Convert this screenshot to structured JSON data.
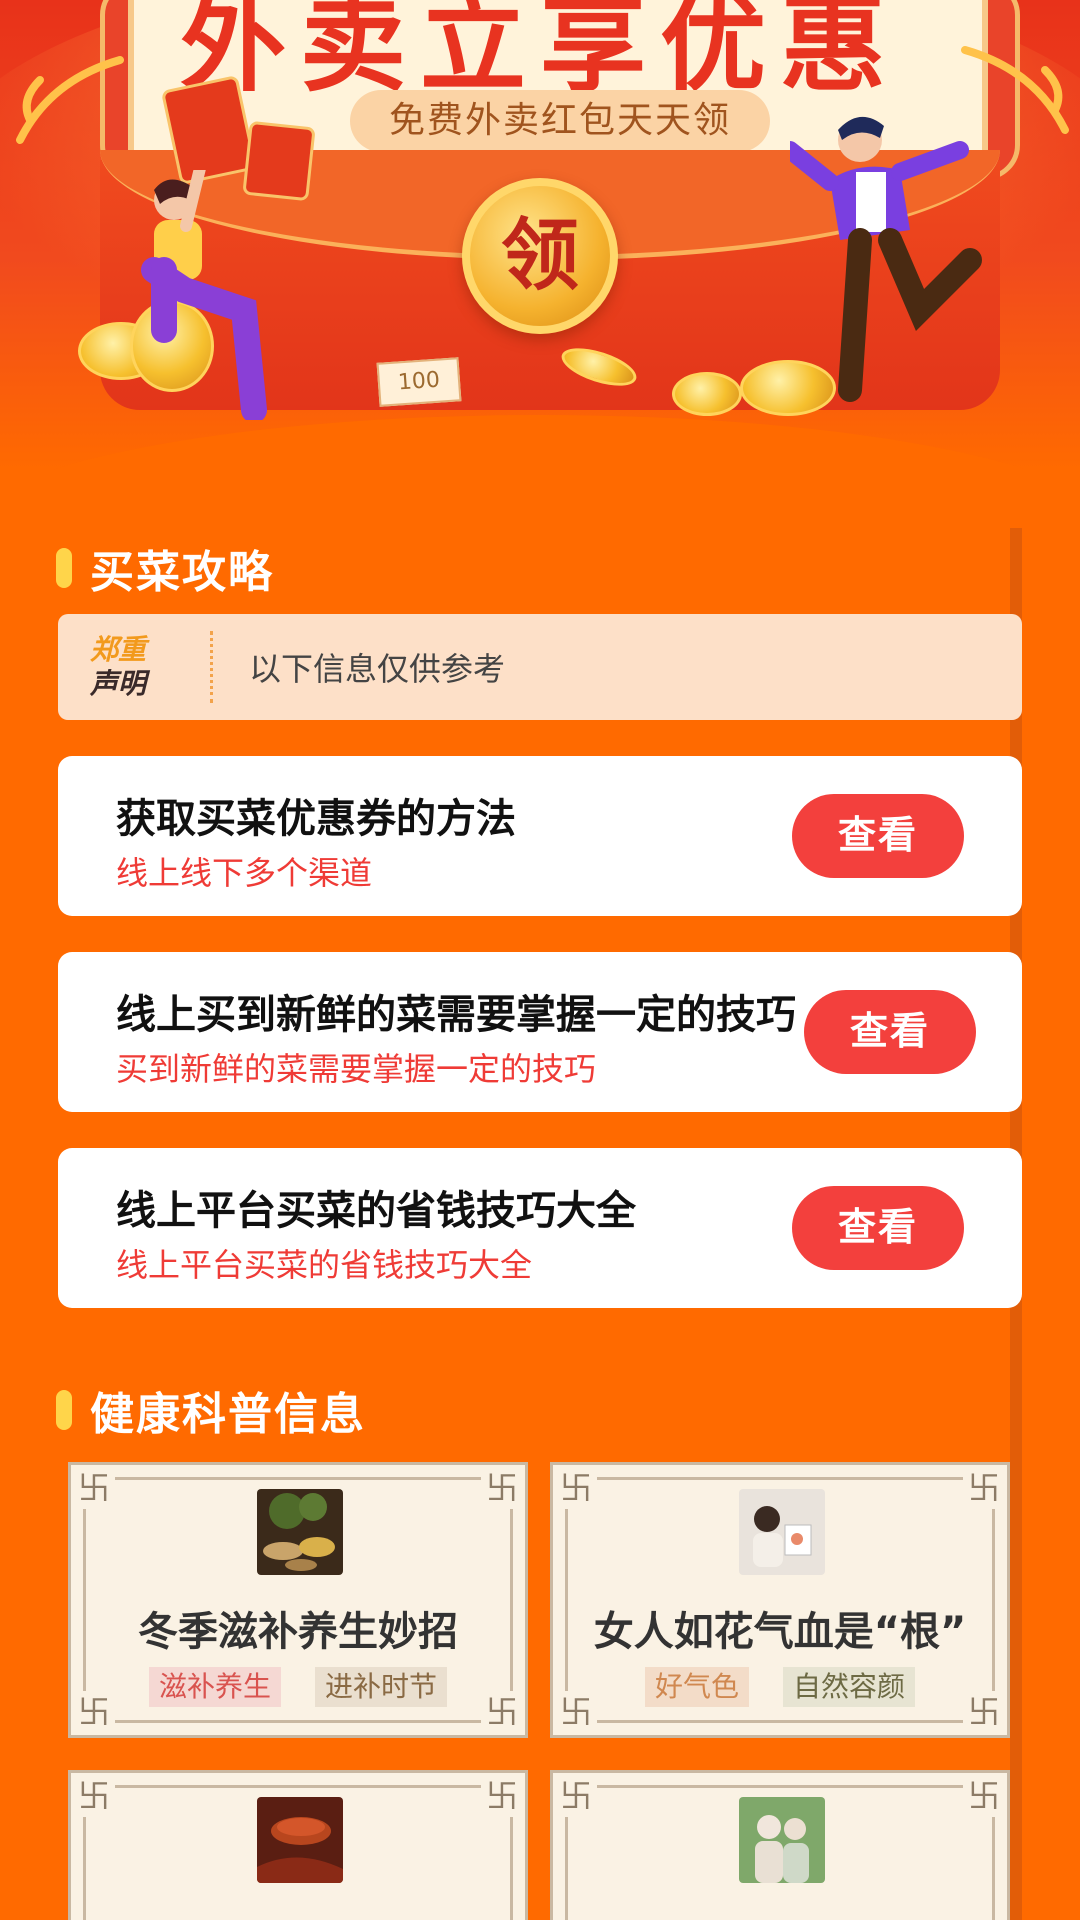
{
  "hero": {
    "title": "外卖立享优惠",
    "subtitle": "免费外卖红包天天领",
    "claim_label": "领",
    "ticket_label": "100"
  },
  "shopping_guide": {
    "section_title": "买菜攻略",
    "notice": {
      "badge_line1": "郑重",
      "badge_line2": "声明",
      "text": "以下信息仅供参考"
    },
    "items": [
      {
        "title": "获取买菜优惠券的方法",
        "subtitle": "线上线下多个渠道",
        "button": "查看"
      },
      {
        "title": "线上买到新鲜的菜需要掌握一定的技巧",
        "subtitle": "买到新鲜的菜需要掌握一定的技巧",
        "button": "查看"
      },
      {
        "title": "线上平台买菜的省钱技巧大全",
        "subtitle": "线上平台买菜的省钱技巧大全",
        "button": "查看"
      }
    ]
  },
  "health_info": {
    "section_title": "健康科普信息",
    "cards": [
      {
        "title": "冬季滋补养生妙招",
        "tags": [
          "滋补养生",
          "进补时节"
        ]
      },
      {
        "title": "女人如花气血是“根”",
        "tags": [
          "好气色",
          "自然容颜"
        ]
      },
      {
        "title": "",
        "tags": []
      },
      {
        "title": "",
        "tags": []
      }
    ]
  },
  "colors": {
    "page_bg": "#ff6a00",
    "accent_red": "#f3403d",
    "section_bar": "#ffd54a",
    "subtitle_red": "#ef3b36"
  }
}
